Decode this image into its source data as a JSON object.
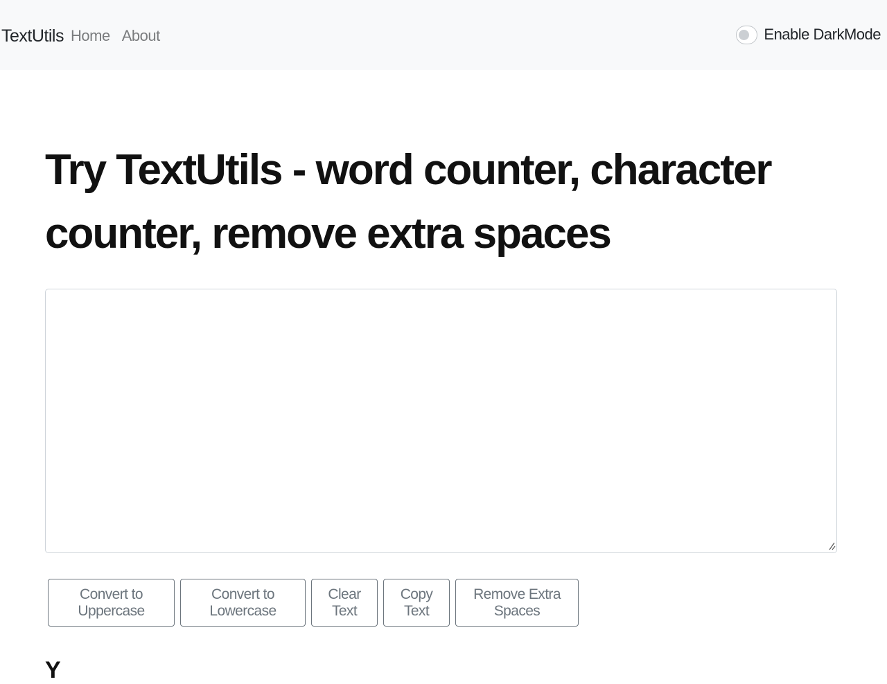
{
  "navbar": {
    "brand": "TextUtils",
    "links": [
      {
        "label": "Home"
      },
      {
        "label": "About"
      }
    ],
    "darkmode_label": "Enable DarkMode",
    "darkmode_enabled": false
  },
  "main": {
    "title": "Try TextUtils - word counter, character counter, remove extra spaces",
    "textarea_value": "",
    "buttons": {
      "uppercase": "Convert to Uppercase",
      "lowercase": "Convert to Lowercase",
      "clear": "Clear Text",
      "copy": "Copy Text",
      "remove_spaces": "Remove Extra Spaces"
    },
    "summary_heading_partial": "Y"
  }
}
